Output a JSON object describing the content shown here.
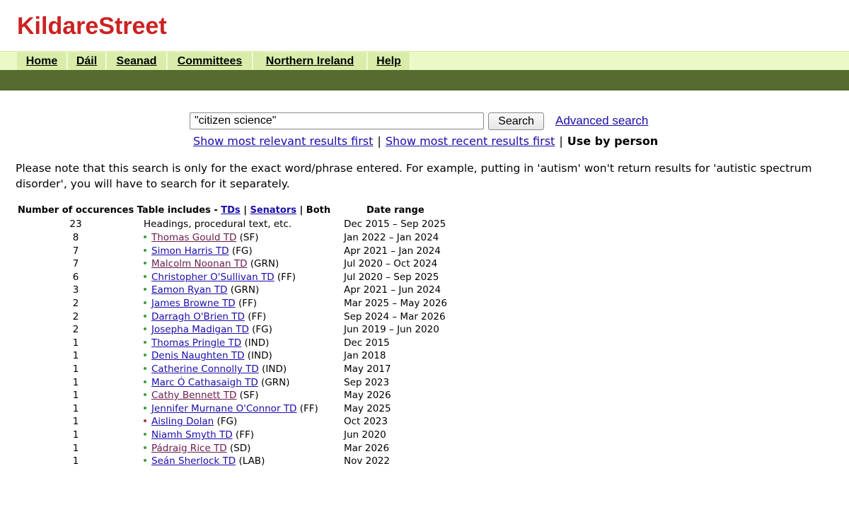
{
  "site": {
    "logo": "KildareStreet"
  },
  "nav": [
    {
      "label": "Home"
    },
    {
      "label": "Dáil"
    },
    {
      "label": "Seanad"
    },
    {
      "label": "Committees"
    },
    {
      "label": "Northern Ireland"
    },
    {
      "label": "Help"
    }
  ],
  "search": {
    "value": "\"citizen science\"",
    "button": "Search",
    "advanced": "Advanced search",
    "sort_relevant": "Show most relevant results first",
    "sort_recent": "Show most recent results first",
    "sort_person": "Use by person",
    "separator": "|"
  },
  "notice": "Please note that this search is only for the exact word/phrase entered. For example, putting in 'autism' won't return results for 'autistic spectrum disorder', you will have to search for it separately.",
  "table": {
    "col_count": "Number of occurences",
    "includes_label": "Table includes -",
    "tds": "TDs",
    "senators": "Senators",
    "both": "Both",
    "col_range": "Date range",
    "sep": "|",
    "first_row": {
      "count": "23",
      "label": "Headings, procedural text, etc.",
      "range": "Dec 2015 – Sep 2025"
    },
    "rows": [
      {
        "count": "8",
        "name": "Thomas Gould TD",
        "party": "(SF)",
        "range": "Jan 2022 – Jan 2024",
        "visited": true,
        "bullet": "#3a9a3a"
      },
      {
        "count": "7",
        "name": "Simon Harris TD",
        "party": "(FG)",
        "range": "Apr 2021 – Jan 2024",
        "visited": false,
        "bullet": "#3a9a3a"
      },
      {
        "count": "7",
        "name": "Malcolm Noonan TD",
        "party": "(GRN)",
        "range": "Jul 2020 – Oct 2024",
        "visited": true,
        "bullet": "#3a9a3a"
      },
      {
        "count": "6",
        "name": "Christopher O'Sullivan TD",
        "party": "(FF)",
        "range": "Jul 2020 – Sep 2025",
        "visited": false,
        "bullet": "#3a9a3a"
      },
      {
        "count": "3",
        "name": "Eamon Ryan TD",
        "party": "(GRN)",
        "range": "Apr 2021 – Jun 2024",
        "visited": false,
        "bullet": "#3a9a3a"
      },
      {
        "count": "2",
        "name": "James Browne TD",
        "party": "(FF)",
        "range": "Mar 2025 – May 2026",
        "visited": false,
        "bullet": "#3a9a3a"
      },
      {
        "count": "2",
        "name": "Darragh O'Brien TD",
        "party": "(FF)",
        "range": "Sep 2024 – Mar 2026",
        "visited": false,
        "bullet": "#3a9a3a"
      },
      {
        "count": "2",
        "name": "Josepha Madigan TD",
        "party": "(FG)",
        "range": "Jun 2019 – Jun 2020",
        "visited": false,
        "bullet": "#3a9a3a"
      },
      {
        "count": "1",
        "name": "Thomas Pringle TD",
        "party": "(IND)",
        "range": "Dec 2015",
        "visited": false,
        "bullet": "#3a9a3a"
      },
      {
        "count": "1",
        "name": "Denis Naughten TD",
        "party": "(IND)",
        "range": "Jan 2018",
        "visited": false,
        "bullet": "#3a9a3a"
      },
      {
        "count": "1",
        "name": "Catherine Connolly TD",
        "party": "(IND)",
        "range": "May 2017",
        "visited": false,
        "bullet": "#3a9a3a"
      },
      {
        "count": "1",
        "name": "Marc Ó Cathasaigh TD",
        "party": "(GRN)",
        "range": "Sep 2023",
        "visited": false,
        "bullet": "#3a9a3a"
      },
      {
        "count": "1",
        "name": "Cathy Bennett TD",
        "party": "(SF)",
        "range": "May 2026",
        "visited": true,
        "bullet": "#3a9a3a"
      },
      {
        "count": "1",
        "name": "Jennifer Murnane O'Connor TD",
        "party": "(FF)",
        "range": "May 2025",
        "visited": false,
        "bullet": "#3a9a3a"
      },
      {
        "count": "1",
        "name": "Aisling Dolan",
        "party": "(FG)",
        "range": "Oct 2023",
        "visited": false,
        "bullet": "#b03030"
      },
      {
        "count": "1",
        "name": "Niamh Smyth TD",
        "party": "(FF)",
        "range": "Jun 2020",
        "visited": false,
        "bullet": "#3a9a3a"
      },
      {
        "count": "1",
        "name": "Pádraig Rice TD",
        "party": "(SD)",
        "range": "Mar 2026",
        "visited": true,
        "bullet": "#3a9a3a"
      },
      {
        "count": "1",
        "name": "Seán Sherlock TD",
        "party": "(LAB)",
        "range": "Nov 2022",
        "visited": false,
        "bullet": "#3a9a3a"
      }
    ]
  }
}
